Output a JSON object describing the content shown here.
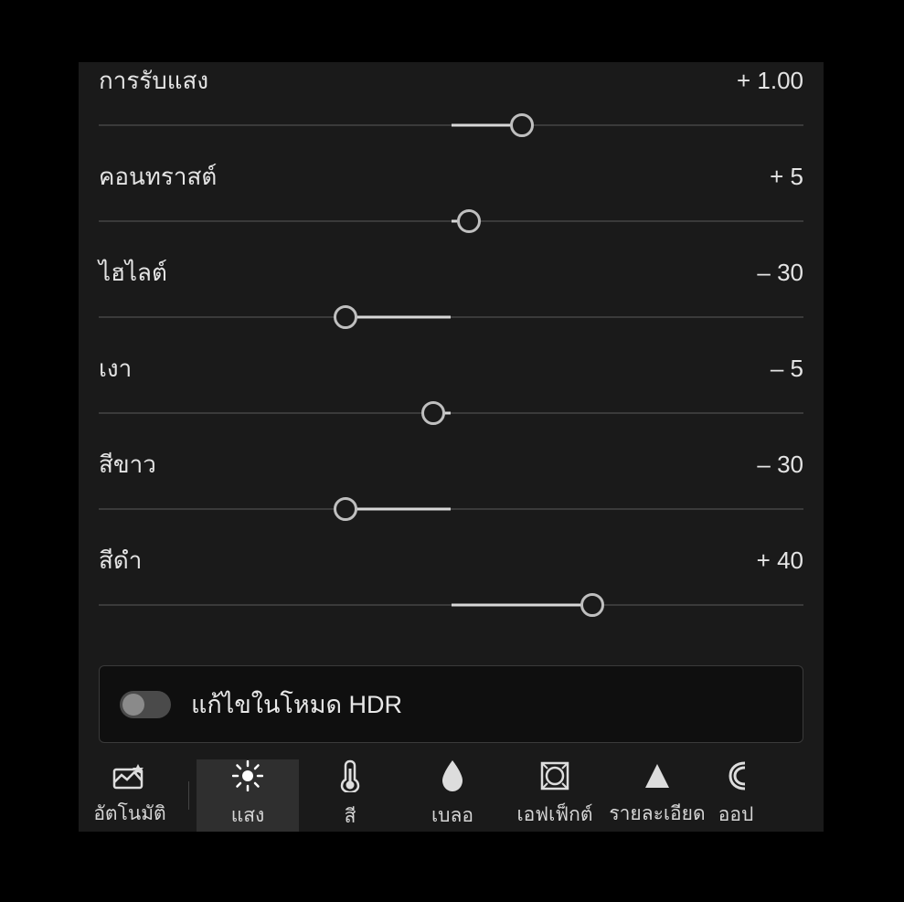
{
  "sliders": [
    {
      "id": "exposure",
      "label": "การรับแสง",
      "value_text": "+ 1.00",
      "percent": 0.6
    },
    {
      "id": "contrast",
      "label": "คอนทราสต์",
      "value_text": "+ 5",
      "percent": 0.525
    },
    {
      "id": "highlights",
      "label": "ไฮไลต์",
      "value_text": "– 30",
      "percent": 0.35
    },
    {
      "id": "shadows",
      "label": "เงา",
      "value_text": "– 5",
      "percent": 0.475
    },
    {
      "id": "whites",
      "label": "สีขาว",
      "value_text": "– 30",
      "percent": 0.35
    },
    {
      "id": "blacks",
      "label": "สีดำ",
      "value_text": "+ 40",
      "percent": 0.7
    }
  ],
  "hdr": {
    "label": "แก้ไขในโหมด HDR",
    "on": false
  },
  "tabs": {
    "auto": {
      "label": "อัตโนมัติ"
    },
    "light": {
      "label": "แสง",
      "active": true
    },
    "color": {
      "label": "สี"
    },
    "blur": {
      "label": "เบลอ"
    },
    "effects": {
      "label": "เอฟเฟ็กต์"
    },
    "detail": {
      "label": "รายละเอียด"
    },
    "optics": {
      "label": "ออป"
    }
  }
}
